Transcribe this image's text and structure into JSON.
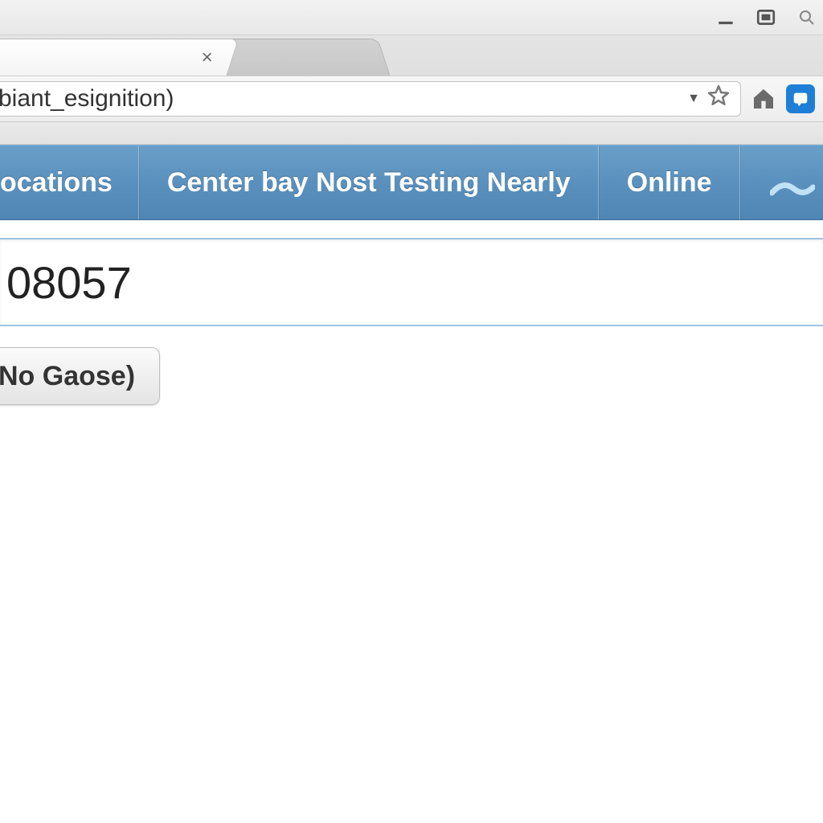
{
  "browser": {
    "url_fragment": "biant_esignition)",
    "tab_close_glyph": "×"
  },
  "navbar": {
    "items": [
      {
        "label": "ocations"
      },
      {
        "label": "Center bay Nost Testing Nearly"
      },
      {
        "label": "Online"
      }
    ]
  },
  "main": {
    "input_value": "08057",
    "button_label": "No Gaose)"
  },
  "colors": {
    "navbar_bg": "#5a90bd",
    "navbar_text": "#ffffff",
    "input_border": "#9fc3e1",
    "extension_bg": "#1f7fd6"
  }
}
